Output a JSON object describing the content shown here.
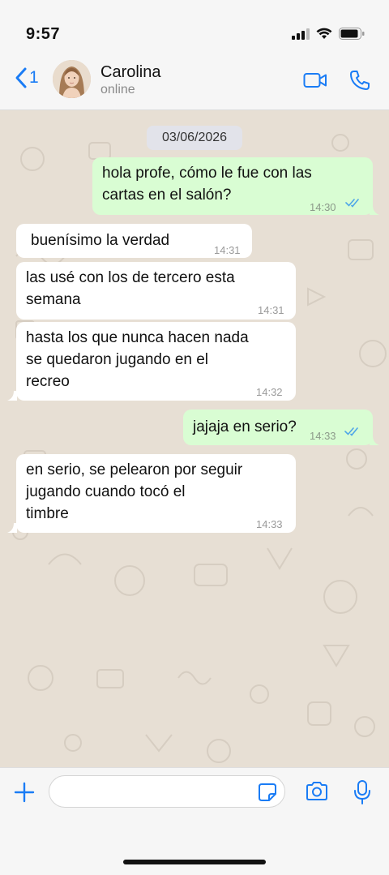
{
  "status_bar": {
    "time": "9:57"
  },
  "header": {
    "back_count": "1",
    "contact_name": "Carolina",
    "contact_status": "online"
  },
  "chat": {
    "date": "03/06/2026",
    "messages": [
      {
        "direction": "out",
        "text": "hola profe, cómo le fue con las cartas en el salón?",
        "line1": "hola profe, cómo le fue con las",
        "line2": "cartas en el salón?",
        "time": "14:30",
        "read": true
      },
      {
        "direction": "in",
        "text": "buenísimo la verdad",
        "time": "14:31"
      },
      {
        "direction": "in",
        "text": "las usé con los de tercero esta semana",
        "line1": "las usé con los de tercero esta",
        "line2": "semana",
        "time": "14:31"
      },
      {
        "direction": "in",
        "text": "hasta los que nunca hacen nada se quedaron jugando en el recreo",
        "line1": "hasta los que nunca hacen nada",
        "line2": "se quedaron jugando en el",
        "line3": "recreo",
        "time": "14:32"
      },
      {
        "direction": "out",
        "text": "jajaja en serio?",
        "time": "14:33",
        "read": true
      },
      {
        "direction": "in",
        "text": "en serio, se pelearon por seguir jugando cuando tocó el timbre",
        "line1": "en serio, se pelearon por seguir",
        "line2": "jugando cuando tocó el",
        "line3": "timbre",
        "time": "14:33"
      }
    ]
  },
  "input": {
    "value": "",
    "placeholder": ""
  },
  "colors": {
    "accent": "#1a7cf5",
    "outgoing_bubble": "#d9fdd3",
    "incoming_bubble": "#ffffff",
    "wallpaper": "#e7dfd4",
    "read_ticks": "#4fa6e8"
  },
  "icons": [
    "back-chevron-icon",
    "video-call-icon",
    "phone-icon",
    "plus-icon",
    "sticker-icon",
    "camera-icon",
    "microphone-icon",
    "double-check-icon"
  ]
}
